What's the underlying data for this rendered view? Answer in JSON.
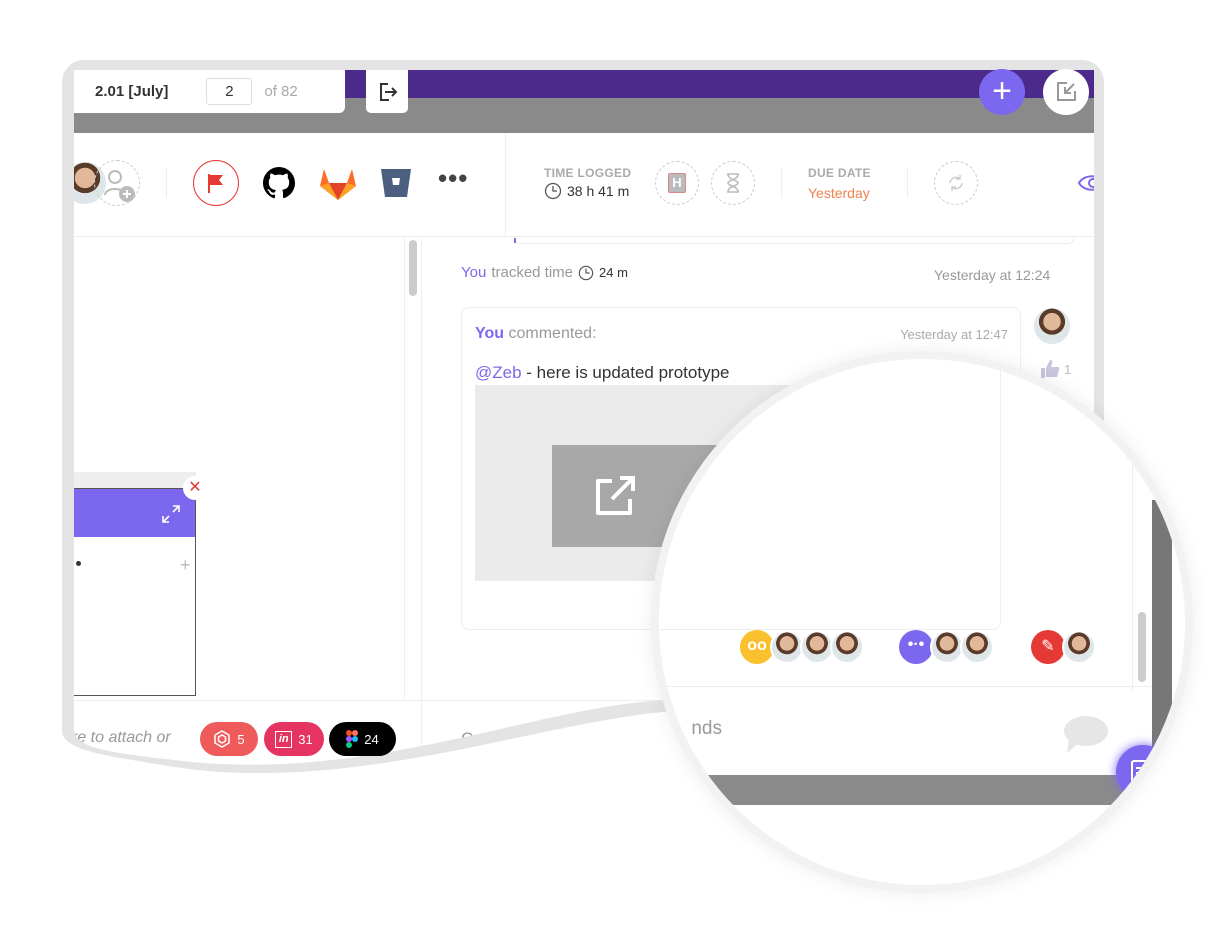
{
  "task_tab": {
    "title": "2.01 [July]",
    "page": "2",
    "of": "of 82"
  },
  "header": {
    "time_logged_label": "TIME LOGGED",
    "time_logged_value": "38 h 41 m",
    "due_date_label": "DUE DATE",
    "due_date_value": "Yesterday",
    "icons": [
      "flag-icon",
      "github-icon",
      "gitlab-icon",
      "bitbucket-icon",
      "more-icon"
    ]
  },
  "activity": {
    "tracked": {
      "who": "You",
      "action": "tracked time",
      "duration": "24 m",
      "time": "Yesterday at 12:24"
    },
    "comment": {
      "who": "You",
      "action": "commented:",
      "time": "Yesterday at 12:47",
      "mention": "@Zeb",
      "text": " - here is updated prototype",
      "likes": "1"
    }
  },
  "bottom": {
    "attach_hint": "re to attach or",
    "comment_placeholder_left": "Com",
    "comment_placeholder_right": "nds"
  },
  "badges": [
    {
      "name": "abstract",
      "count": "5",
      "color": "#ef5a5a"
    },
    {
      "name": "invision",
      "count": "31",
      "color": "#e63462"
    },
    {
      "name": "figma",
      "count": "24",
      "color": "#000000"
    }
  ],
  "colors": {
    "accent": "#7b68ee",
    "due": "#f0814e",
    "top_band": "#4b2a8c"
  }
}
